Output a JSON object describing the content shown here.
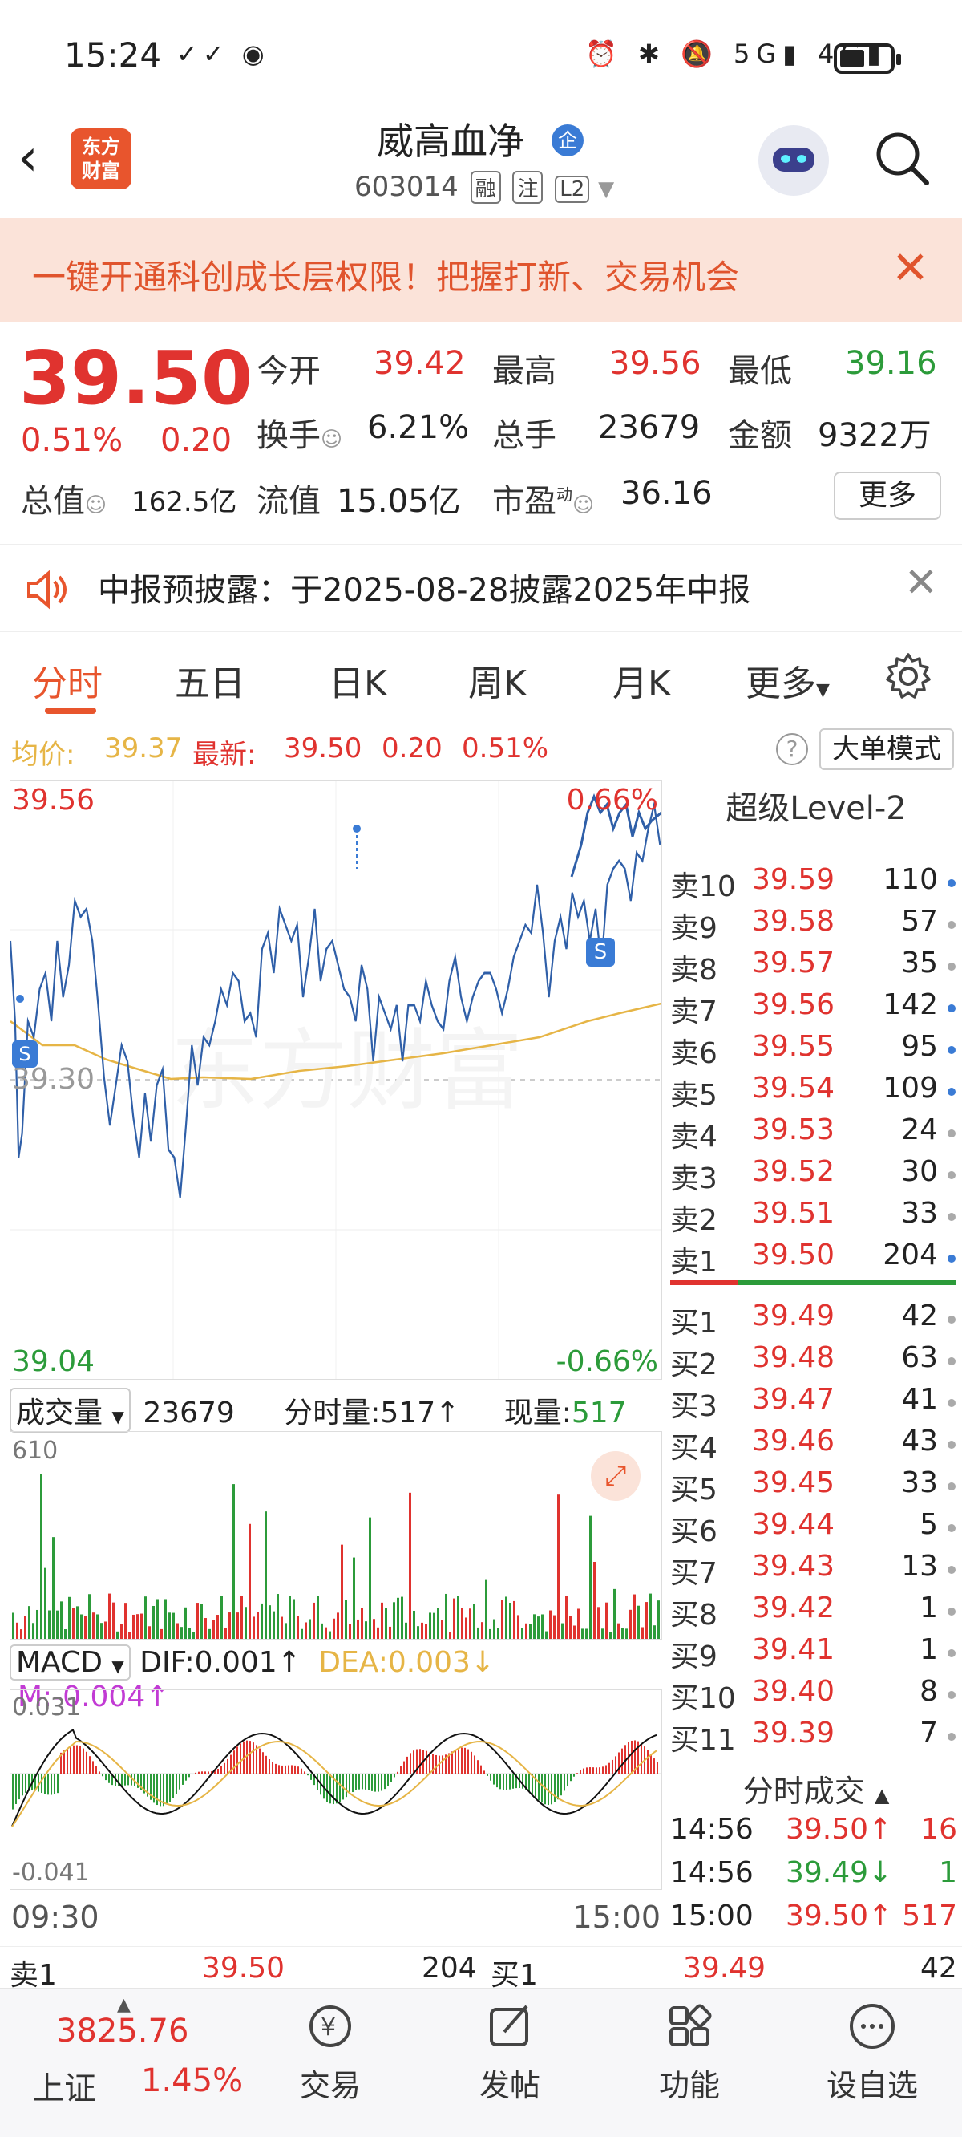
{
  "status_bar": {
    "time": "15:24",
    "signal_5g": "5G",
    "signal_4g": "4G"
  },
  "header": {
    "back_icon": "back-arrow-icon",
    "logo_text_line1": "东方",
    "logo_text_line2": "财富",
    "title": "威高血净",
    "title_badge": "企",
    "code": "603014",
    "tags": [
      "融",
      "注",
      "L2"
    ]
  },
  "banner": {
    "text": "一键开通科创成长层权限！把握打新、交易机会",
    "close": "✕"
  },
  "quote": {
    "price": "39.50",
    "change_pct": "0.51%",
    "change": "0.20",
    "open_label": "今开",
    "open": "39.42",
    "high_label": "最高",
    "high": "39.56",
    "low_label": "最低",
    "low": "39.16",
    "turnover_label": "换手",
    "turnover": "6.21%",
    "volume_label": "总手",
    "volume": "23679",
    "amount_label": "金额",
    "amount": "9322万",
    "mcap_label": "总值",
    "mcap": "162.5亿",
    "float_label": "流值",
    "float": "15.05亿",
    "pe_label": "市盈",
    "pe_sup": "动",
    "pe": "36.16",
    "more": "更多"
  },
  "notice": {
    "text": "中报预披露：于2025-08-28披露2025年中报",
    "close": "✕"
  },
  "tabs": [
    "分时",
    "五日",
    "日K",
    "周K",
    "月K",
    "更多"
  ],
  "avg_bar": {
    "avg_label": "均价:",
    "avg": "39.37",
    "latest_label": "最新:",
    "latest": "39.50",
    "chg": "0.20",
    "pct": "0.51%",
    "big_order": "大单模式"
  },
  "chart_labels": {
    "top_price": "39.56",
    "top_pct": "0.66%",
    "bottom_price": "39.04",
    "bottom_pct": "-0.66%",
    "mid_price": "39.30",
    "s_marker": "S"
  },
  "level2": {
    "title": "超级Level-2",
    "asks": [
      {
        "label": "卖10",
        "price": "39.59",
        "vol": "110",
        "dot": "#3a7bd5"
      },
      {
        "label": "卖9",
        "price": "39.58",
        "vol": "57",
        "dot": "#aaaaaa"
      },
      {
        "label": "卖8",
        "price": "39.57",
        "vol": "35",
        "dot": "#aaaaaa"
      },
      {
        "label": "卖7",
        "price": "39.56",
        "vol": "142",
        "dot": "#3a7bd5"
      },
      {
        "label": "卖6",
        "price": "39.55",
        "vol": "95",
        "dot": "#3a7bd5"
      },
      {
        "label": "卖5",
        "price": "39.54",
        "vol": "109",
        "dot": "#3a7bd5"
      },
      {
        "label": "卖4",
        "price": "39.53",
        "vol": "24",
        "dot": "#aaaaaa"
      },
      {
        "label": "卖3",
        "price": "39.52",
        "vol": "30",
        "dot": "#aaaaaa"
      },
      {
        "label": "卖2",
        "price": "39.51",
        "vol": "33",
        "dot": "#aaaaaa"
      },
      {
        "label": "卖1",
        "price": "39.50",
        "vol": "204",
        "dot": "#3a7bd5"
      }
    ],
    "bids": [
      {
        "label": "买1",
        "price": "39.49",
        "vol": "42",
        "dot": "#aaaaaa"
      },
      {
        "label": "买2",
        "price": "39.48",
        "vol": "63",
        "dot": "#aaaaaa"
      },
      {
        "label": "买3",
        "price": "39.47",
        "vol": "41",
        "dot": "#aaaaaa"
      },
      {
        "label": "买4",
        "price": "39.46",
        "vol": "43",
        "dot": "#aaaaaa"
      },
      {
        "label": "买5",
        "price": "39.45",
        "vol": "33",
        "dot": "#aaaaaa"
      },
      {
        "label": "买6",
        "price": "39.44",
        "vol": "5",
        "dot": "#aaaaaa"
      },
      {
        "label": "买7",
        "price": "39.43",
        "vol": "13",
        "dot": "#aaaaaa"
      },
      {
        "label": "买8",
        "price": "39.42",
        "vol": "1",
        "dot": "#aaaaaa"
      },
      {
        "label": "买9",
        "price": "39.41",
        "vol": "1",
        "dot": "#aaaaaa"
      },
      {
        "label": "买10",
        "price": "39.40",
        "vol": "8",
        "dot": "#aaaaaa"
      },
      {
        "label": "买11",
        "price": "39.39",
        "vol": "7",
        "dot": "#aaaaaa"
      }
    ],
    "trades_title": "分时成交",
    "trades": [
      {
        "time": "14:56",
        "price": "39.50↑",
        "vol": "16",
        "dir": "up"
      },
      {
        "time": "14:56",
        "price": "39.49↓",
        "vol": "1",
        "dir": "down"
      },
      {
        "time": "15:00",
        "price": "39.50↑",
        "vol": "517",
        "dir": "up"
      }
    ]
  },
  "volume_panel": {
    "selector": "成交量",
    "total": "23679",
    "tick_label": "分时量:517",
    "now_label": "现量:",
    "now": "517",
    "max": "610"
  },
  "macd_panel": {
    "selector": "MACD",
    "dif": "DIF:0.001",
    "dea": "DEA:0.003",
    "m": "M:-0.004",
    "top": "0.031",
    "bottom": "-0.041"
  },
  "time_axis": {
    "start": "09:30",
    "end": "15:00"
  },
  "bottom_book": {
    "ask_label": "卖1",
    "ask_price": "39.50",
    "ask_vol": "204",
    "bid_label": "买1",
    "bid_price": "39.49",
    "bid_vol": "42"
  },
  "nav": {
    "index_value": "3825.76",
    "index_name": "上证",
    "index_pct": "1.45%",
    "items": [
      "交易",
      "发帖",
      "功能",
      "设自选"
    ]
  },
  "colors": {
    "up": "#e0332f",
    "down": "#2c9b3a",
    "accent": "#e8552d",
    "price_line": "#2f5fa8",
    "avg_line": "#e6b546"
  }
}
